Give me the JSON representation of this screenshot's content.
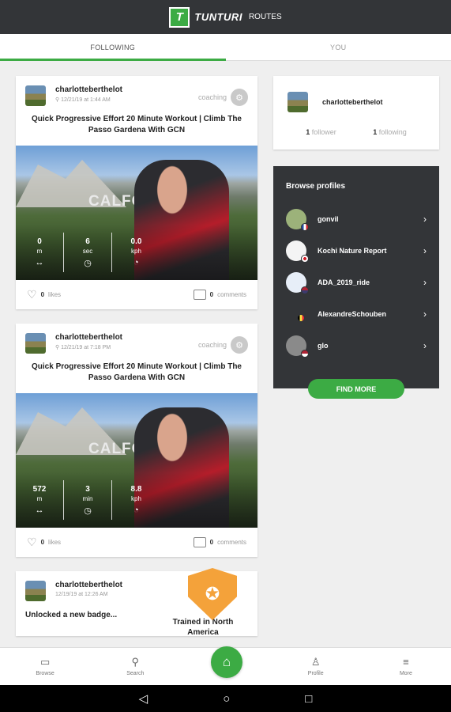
{
  "app": {
    "logo_letter": "T",
    "logo_name": "TUNTURI",
    "logo_sub": "ROUTES"
  },
  "tabs": [
    {
      "label": "FOLLOWING"
    },
    {
      "label": "YOU"
    }
  ],
  "feed": [
    {
      "username": "charlotteberthelot",
      "timestamp": "12/21/19 at 1:44 AM",
      "tag": "coaching",
      "title": "Quick Progressive Effort 20 Minute Workout | Climb The Passo Gardena With GCN",
      "sign": "CALFO",
      "stats": [
        {
          "value": "0",
          "unit": "m",
          "icon": "↔"
        },
        {
          "value": "6",
          "unit": "sec",
          "icon": "◷"
        },
        {
          "value": "0.0",
          "unit": "kph",
          "icon": "◔"
        }
      ],
      "likes": "0",
      "likes_label": "likes",
      "comments": "0",
      "comments_label": "comments"
    },
    {
      "username": "charlotteberthelot",
      "timestamp": "12/21/19 at 7:18 PM",
      "tag": "coaching",
      "title": "Quick Progressive Effort 20 Minute Workout | Climb The Passo Gardena With GCN",
      "sign": "CALFO",
      "stats": [
        {
          "value": "572",
          "unit": "m",
          "icon": "↔"
        },
        {
          "value": "3",
          "unit": "min",
          "icon": "◷"
        },
        {
          "value": "8.8",
          "unit": "kph",
          "icon": "◔"
        }
      ],
      "likes": "0",
      "likes_label": "likes",
      "comments": "0",
      "comments_label": "comments"
    },
    {
      "username": "charlotteberthelot",
      "timestamp": "12/19/19 at 12:26 AM",
      "text": "Unlocked a new badge...",
      "badge_label": "Trained in North America"
    }
  ],
  "profile": {
    "username": "charlotteberthelot",
    "followers": "1",
    "followers_label": "follower",
    "following": "1",
    "following_label": "following"
  },
  "browse": {
    "title": "Browse profiles",
    "items": [
      {
        "name": "gonvil"
      },
      {
        "name": "Kochi Nature Report"
      },
      {
        "name": "ADA_2019_ride"
      },
      {
        "name": "AlexandreSchouben"
      },
      {
        "name": "glo"
      }
    ],
    "button": "FIND MORE"
  },
  "bottom_nav": [
    {
      "label": "Browse",
      "icon": "folder-icon"
    },
    {
      "label": "Search",
      "icon": "search-icon"
    },
    {
      "label": "Profile",
      "icon": "person-icon"
    },
    {
      "label": "More",
      "icon": "menu-icon"
    }
  ],
  "colors": {
    "accent": "#3cab44",
    "header": "#333538",
    "badge": "#f4a23a"
  }
}
